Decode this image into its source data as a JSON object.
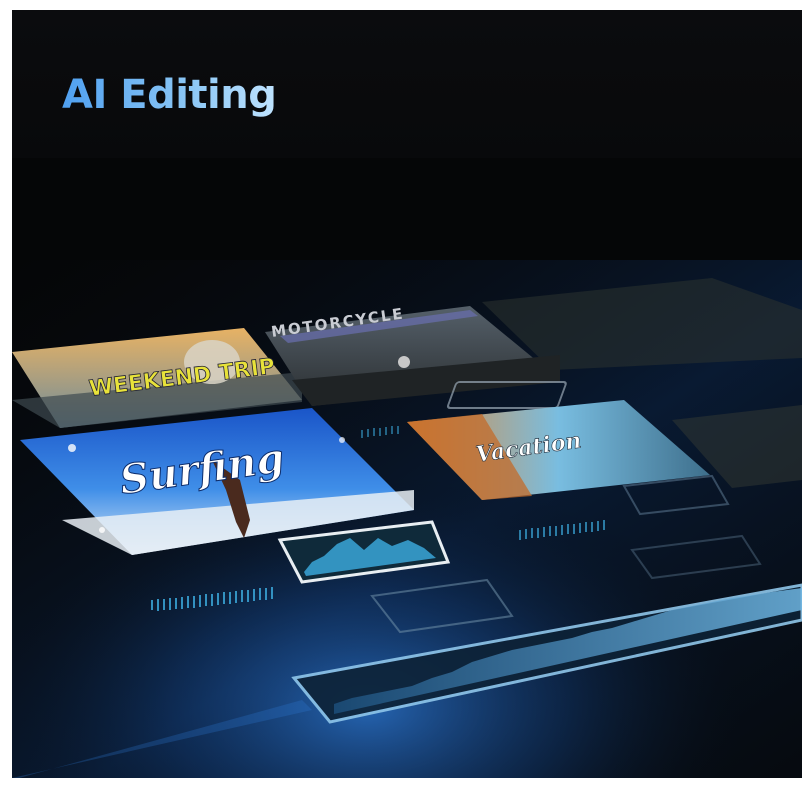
{
  "banner": {
    "title": "AI Editing"
  },
  "cards": {
    "weekend_trip": "WEEKEND TRIP",
    "motorcycle": "MOTORCYCLE",
    "surfing": "Surfing",
    "vacation": "Vacation"
  },
  "colors": {
    "background": "#050607",
    "title_gradient_start": "#4fa0f0",
    "title_gradient_end": "#bfe3ff",
    "accent_glow": "#2f7fe0",
    "waveform": "#3aa6d8"
  }
}
